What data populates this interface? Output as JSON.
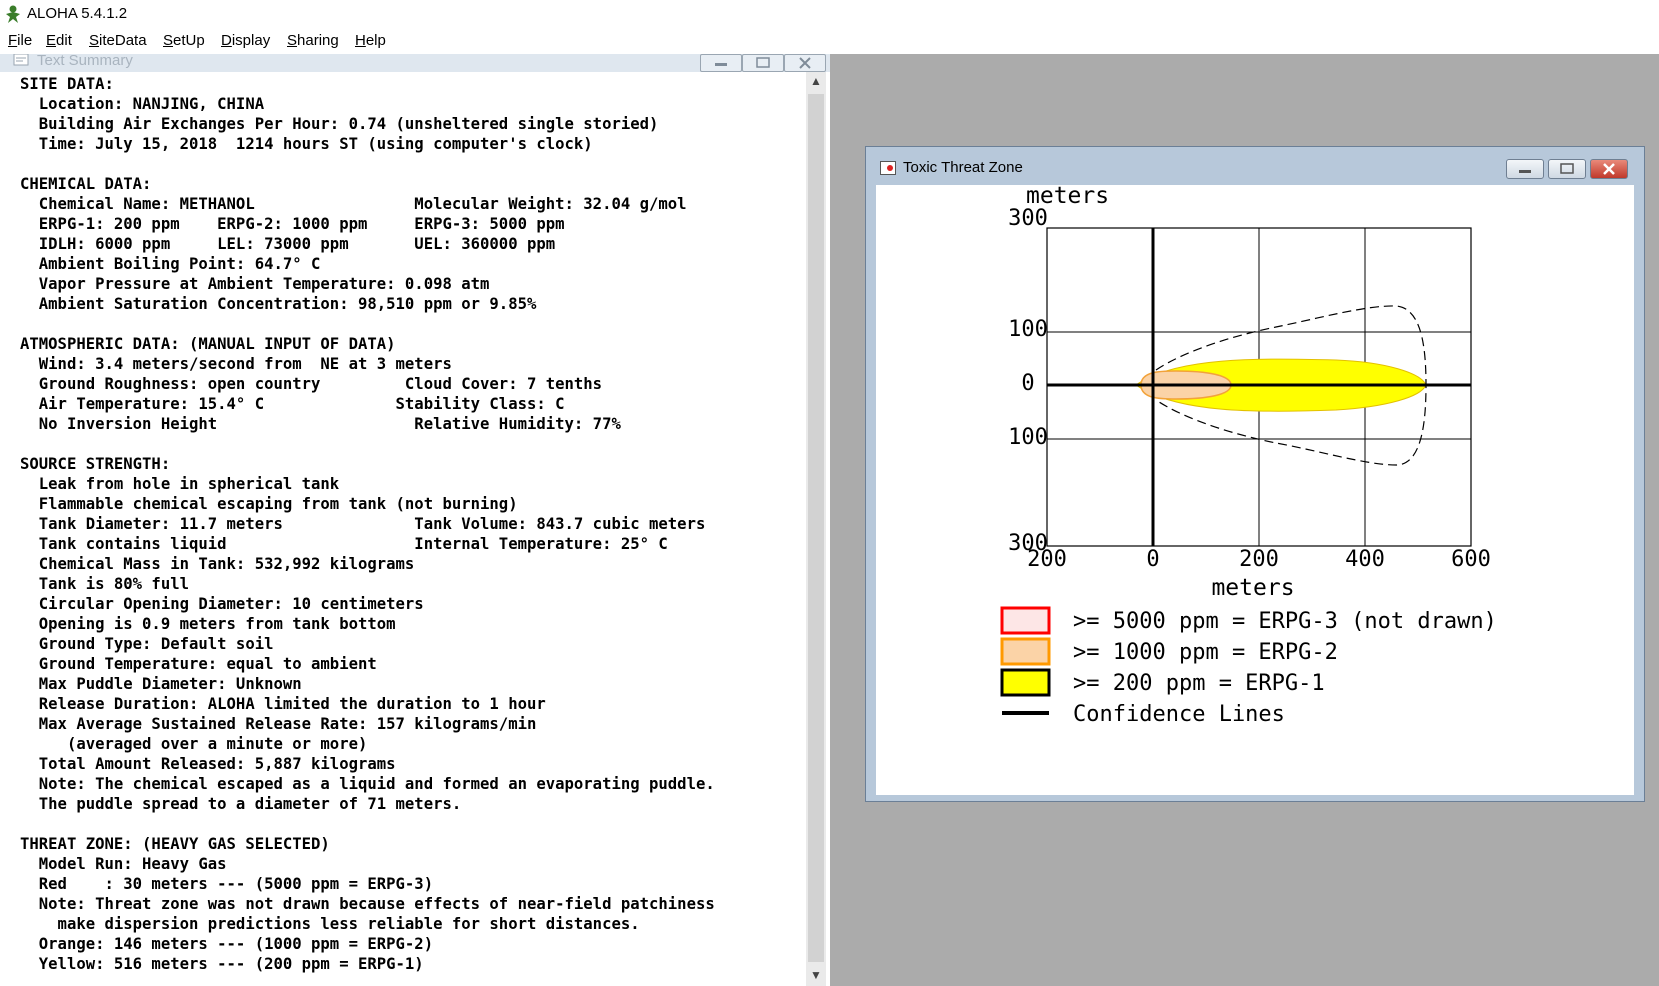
{
  "app": {
    "title": "ALOHA 5.4.1.2",
    "menu": [
      "File",
      "Edit",
      "SiteData",
      "SetUp",
      "Display",
      "Sharing",
      "Help"
    ]
  },
  "text_summary": {
    "title": "Text Summary",
    "lines": [
      "SITE DATA:",
      "  Location: NANJING, CHINA",
      "  Building Air Exchanges Per Hour: 0.74 (unsheltered single storied)",
      "  Time: July 15, 2018  1214 hours ST (using computer's clock)",
      "",
      "CHEMICAL DATA:",
      "  Chemical Name: METHANOL                 Molecular Weight: 32.04 g/mol",
      "  ERPG-1: 200 ppm    ERPG-2: 1000 ppm     ERPG-3: 5000 ppm",
      "  IDLH: 6000 ppm     LEL: 73000 ppm       UEL: 360000 ppm",
      "  Ambient Boiling Point: 64.7° C",
      "  Vapor Pressure at Ambient Temperature: 0.098 atm",
      "  Ambient Saturation Concentration: 98,510 ppm or 9.85%",
      "",
      "ATMOSPHERIC DATA: (MANUAL INPUT OF DATA)",
      "  Wind: 3.4 meters/second from  NE at 3 meters",
      "  Ground Roughness: open country         Cloud Cover: 7 tenths",
      "  Air Temperature: 15.4° C              Stability Class: C",
      "  No Inversion Height                     Relative Humidity: 77%",
      "",
      "SOURCE STRENGTH:",
      "  Leak from hole in spherical tank",
      "  Flammable chemical escaping from tank (not burning)",
      "  Tank Diameter: 11.7 meters              Tank Volume: 843.7 cubic meters",
      "  Tank contains liquid                    Internal Temperature: 25° C",
      "  Chemical Mass in Tank: 532,992 kilograms",
      "  Tank is 80% full",
      "  Circular Opening Diameter: 10 centimeters",
      "  Opening is 0.9 meters from tank bottom",
      "  Ground Type: Default soil",
      "  Ground Temperature: equal to ambient",
      "  Max Puddle Diameter: Unknown",
      "  Release Duration: ALOHA limited the duration to 1 hour",
      "  Max Average Sustained Release Rate: 157 kilograms/min",
      "     (averaged over a minute or more)",
      "  Total Amount Released: 5,887 kilograms",
      "  Note: The chemical escaped as a liquid and formed an evaporating puddle.",
      "  The puddle spread to a diameter of 71 meters.",
      "",
      "THREAT ZONE: (HEAVY GAS SELECTED)",
      "  Model Run: Heavy Gas",
      "  Red    : 30 meters --- (5000 ppm = ERPG-3)",
      "  Note: Threat zone was not drawn because effects of near-field patchiness",
      "    make dispersion predictions less reliable for short distances.",
      "  Orange: 146 meters --- (1000 ppm = ERPG-2)",
      "  Yellow: 516 meters --- (200 ppm = ERPG-1)"
    ]
  },
  "threat_zone": {
    "title": "Toxic Threat Zone",
    "y_unit": "meters",
    "x_unit": "meters",
    "y_ticks": [
      "300",
      "100",
      "0",
      "100",
      "300"
    ],
    "x_ticks": [
      "200",
      "0",
      "200",
      "400",
      "600"
    ],
    "legend": [
      {
        "label": ">= 5000 ppm = ERPG-3 (not drawn)",
        "color": "#ff0000",
        "fill": "#fde6e6"
      },
      {
        "label": ">= 1000 ppm = ERPG-2",
        "color": "#ff9900",
        "fill": "#fbd3a7"
      },
      {
        "label": ">= 200 ppm = ERPG-1",
        "color": "#000000",
        "fill": "#ffff00"
      },
      {
        "label": "Confidence Lines",
        "color": "#000000",
        "fill": ""
      }
    ],
    "zones": {
      "orange_m": 146,
      "yellow_m": 516,
      "orange_color": "#fbd3a7",
      "yellow_color": "#ffff00"
    }
  }
}
